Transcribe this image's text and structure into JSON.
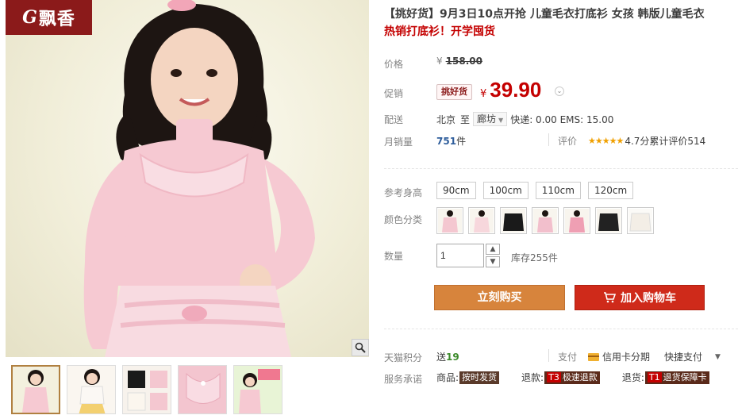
{
  "gallery": {
    "logo": {
      "mark": "G",
      "brand": "飘香"
    },
    "zoom_icon": "magnifier-icon",
    "thumbnails": [
      {
        "name": "thumb-pink-front",
        "active": true
      },
      {
        "name": "thumb-white-front",
        "active": false
      },
      {
        "name": "thumb-colors-layout",
        "active": false
      },
      {
        "name": "thumb-detail-collar",
        "active": false
      },
      {
        "name": "thumb-poster",
        "active": false
      }
    ]
  },
  "product": {
    "title": "【挑好货】9月3日10点开抢 儿童毛衣打底衫 女孩 韩版儿童毛衣",
    "subtitle": "热销打底衫！开学囤货"
  },
  "price": {
    "label": "价格",
    "currency": "¥",
    "original": "158.00",
    "promo_label": "促销",
    "promo_tag": "挑好货",
    "current": "39.90"
  },
  "shipping": {
    "label": "配送",
    "from": "北京",
    "to_word": "至",
    "destination": "廊坊",
    "fees": "快递: 0.00 EMS: 15.00"
  },
  "sales": {
    "label": "月销量",
    "count": "751",
    "unit": "件",
    "review_label": "评价",
    "stars": "★★★★★",
    "rating_text": "4.7分累计评价514"
  },
  "options": {
    "size_label": "参考身高",
    "sizes": [
      "90cm",
      "100cm",
      "110cm",
      "120cm"
    ],
    "color_label": "颜色分类",
    "colors": [
      {
        "name": "swatch-pink",
        "color": "#f4c7d0"
      },
      {
        "name": "swatch-light-pink",
        "color": "#f7d7dc"
      },
      {
        "name": "swatch-black",
        "color": "#1a1a1a"
      },
      {
        "name": "swatch-pink-2",
        "color": "#f2bfcc"
      },
      {
        "name": "swatch-rose",
        "color": "#ef9fb3"
      },
      {
        "name": "swatch-black-2",
        "color": "#222222"
      },
      {
        "name": "swatch-white",
        "color": "#f3eee6"
      }
    ]
  },
  "quantity": {
    "label": "数量",
    "value": "1",
    "stock": "库存255件"
  },
  "actions": {
    "buy_label": "立刻购买",
    "cart_label": "加入购物车"
  },
  "extras": {
    "points_label": "天猫积分",
    "points_prefix": "送",
    "points_value": "19",
    "pay_label": "支付",
    "credit": "信用卡分期",
    "quick": "快捷支付",
    "service_label": "服务承诺",
    "services": [
      {
        "prefix": "商品:",
        "badge": "按时发货"
      },
      {
        "prefix": "退款:",
        "code": "T3",
        "badge": "极速退款"
      },
      {
        "prefix": "退货:",
        "code": "T1",
        "badge": "退货保障卡"
      }
    ]
  },
  "colors": {
    "accent_red": "#c40000",
    "buy_orange": "#d7843c",
    "cart_red": "#cf2a1a",
    "star": "#f0a000"
  }
}
